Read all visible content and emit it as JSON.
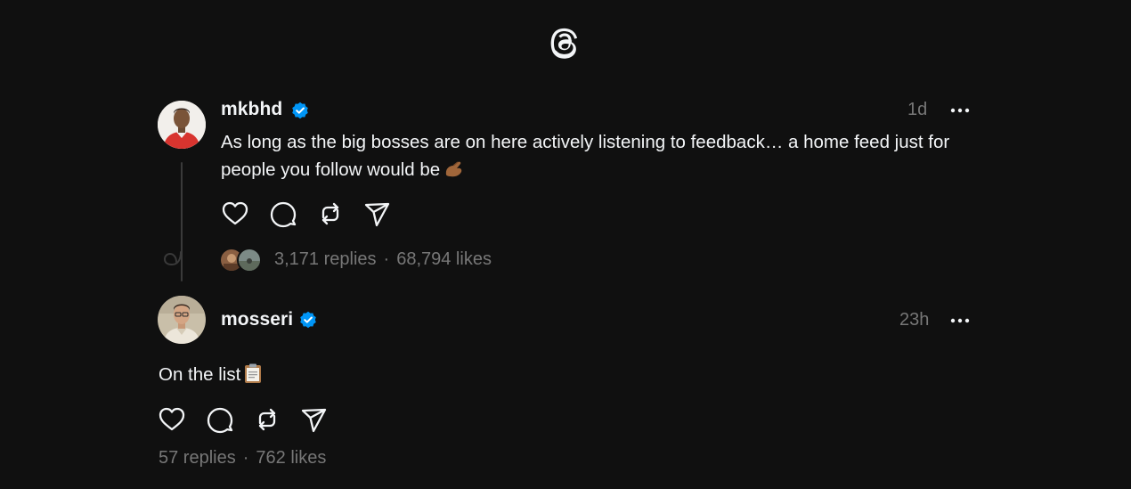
{
  "header": {
    "logo_icon": "threads-logo-icon"
  },
  "posts": [
    {
      "username": "mkbhd",
      "verified": true,
      "timestamp": "1d",
      "text": "As long as the big bosses are on here actively listening to feedback… a home feed just for people you follow would be",
      "emoji_icon": "pinching-hand-emoji",
      "actions": [
        "like-icon",
        "reply-icon",
        "repost-icon",
        "share-icon"
      ],
      "replies": "3,171 replies",
      "separator": "·",
      "likes": "68,794 likes"
    },
    {
      "username": "mosseri",
      "verified": true,
      "timestamp": "23h",
      "text": "On the list",
      "emoji_icon": "clipboard-emoji",
      "actions": [
        "like-icon",
        "reply-icon",
        "repost-icon",
        "share-icon"
      ],
      "replies": "57 replies",
      "separator": "·",
      "likes": "762 likes"
    }
  ],
  "colors": {
    "background": "#101010",
    "text": "#f3f5f7",
    "muted": "#777777",
    "verified": "#0095f6"
  }
}
